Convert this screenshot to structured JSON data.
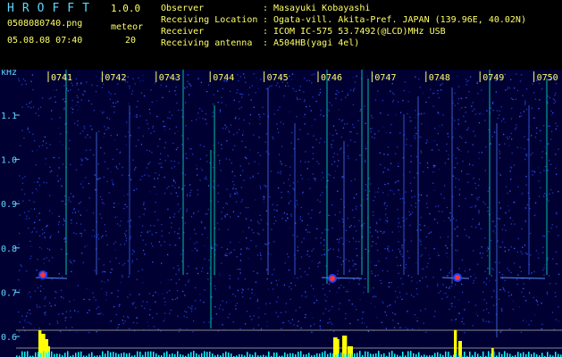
{
  "app": {
    "title": "HROFFT",
    "version": "1.0.0",
    "file_name": "0508080740.png",
    "datetime": "05.08.08 07:40",
    "meteor_label": "meteor",
    "meteor_count": "20"
  },
  "info": [
    {
      "key": "Observer",
      "value": "Masayuki Kobayashi"
    },
    {
      "key": "Receiving Location",
      "value": "Ogata-vill. Akita-Pref. JAPAN (139.96E, 40.02N)"
    },
    {
      "key": "Receiver",
      "value": "ICOM IC-575 53.7492(@LCD)MHz USB"
    },
    {
      "key": "Receiving antenna",
      "value": "A504HB(yagi 4el)"
    }
  ],
  "spectrogram": {
    "unit_label": "kHz",
    "freq_ticks": [
      "1.1",
      "1.0",
      "0.9",
      "0.8",
      "0.7",
      "0.6"
    ],
    "time_ticks": [
      "0741",
      "0742",
      "0743",
      "0744",
      "0745",
      "0746",
      "0747",
      "0748",
      "0749",
      "0750"
    ],
    "colors": {
      "background": "#000033",
      "noise": "#1e3cc8",
      "tick_text": "#ffff66",
      "freq_text": "#5fd7ff",
      "meteor_line": "#00ffcc",
      "echo_core": "#ff3333",
      "amplitude": "#ffff00",
      "amplitude_baseline": "#00ffff"
    }
  }
}
